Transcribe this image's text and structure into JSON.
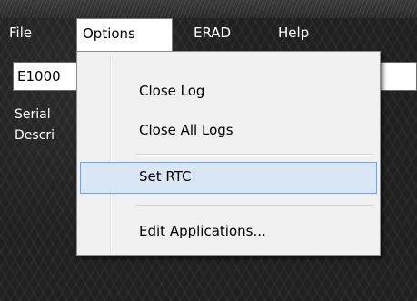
{
  "menubar": {
    "file": "File",
    "options": "Options",
    "erad": "ERAD",
    "help": "Help"
  },
  "device": {
    "id_value": "E1000"
  },
  "info": {
    "serial_label": "Serial",
    "description_label": "Descri"
  },
  "options_menu": {
    "items": [
      {
        "label": "Close Log"
      },
      {
        "label": "Close All Logs"
      },
      {
        "label": "Set RTC"
      },
      {
        "label": "Edit Applications..."
      }
    ],
    "highlighted_index": 2
  },
  "colors": {
    "background": "#202020",
    "menu_bg": "#f0f0f0",
    "highlight_bg": "#d8e6f5",
    "highlight_border": "#7da2ce"
  }
}
